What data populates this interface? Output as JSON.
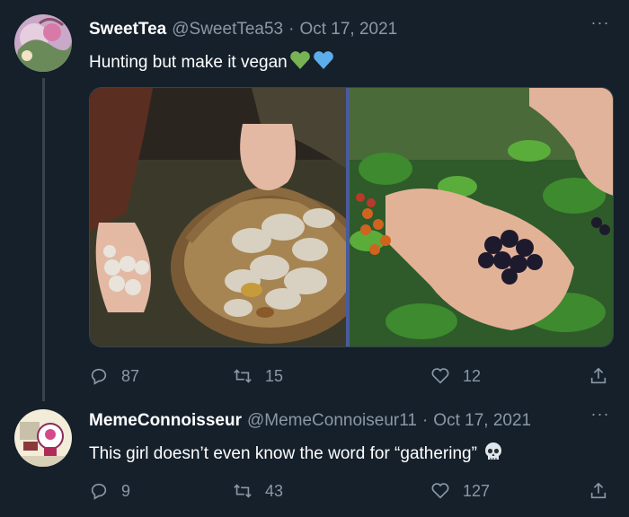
{
  "tweets": [
    {
      "name": "SweetTea",
      "handle": "@SweetTea53",
      "dot": "·",
      "date": "Oct 17, 2021",
      "text": "Hunting but make it vegan",
      "emojis": [
        "green-heart",
        "blue-heart"
      ],
      "replies": "87",
      "retweets": "15",
      "likes": "12",
      "media": [
        "mushroom-basket-photo",
        "blackberries-photo"
      ]
    },
    {
      "name": "MemeConnoisseur",
      "handle": "@MemeConnoiseur11",
      "dot": "·",
      "date": "Oct 17, 2021",
      "text": "This girl doesn’t even know the word for “gathering”",
      "emojis": [
        "skull"
      ],
      "replies": "9",
      "retweets": "43",
      "likes": "127"
    }
  ],
  "more_label": "···",
  "colors": {
    "background": "#15202b",
    "divider": "#38444d",
    "muted": "#8b98a5",
    "text": "#ffffff"
  }
}
